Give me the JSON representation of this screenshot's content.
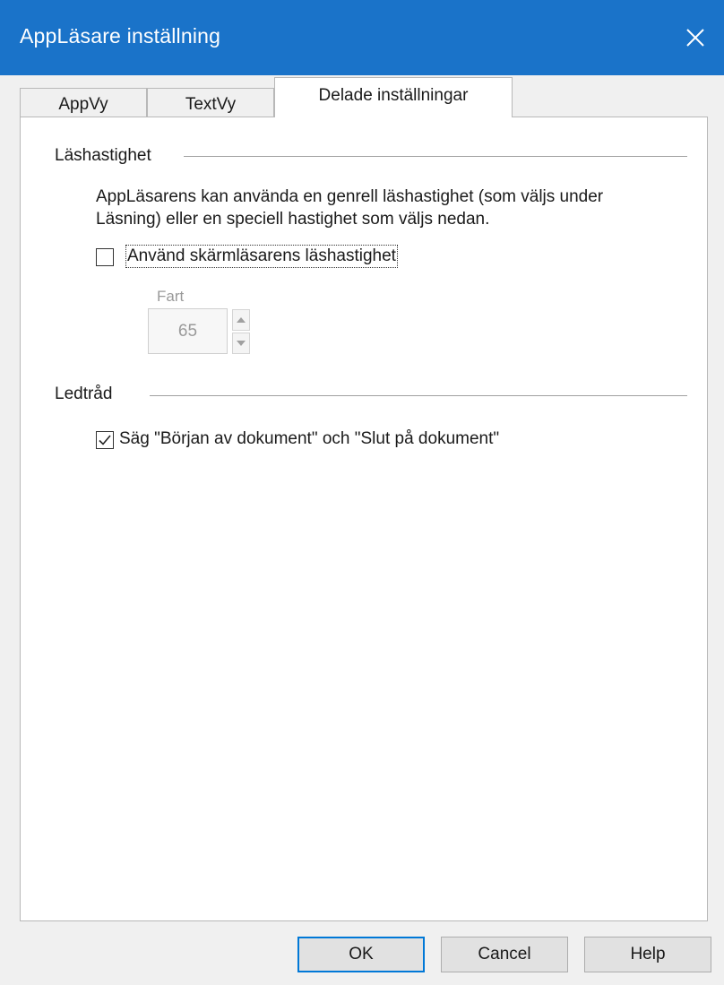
{
  "window": {
    "title": "AppLäsare inställning"
  },
  "tabs": [
    {
      "label": "AppVy",
      "active": false
    },
    {
      "label": "TextVy",
      "active": false
    },
    {
      "label": "Delade inställningar",
      "active": true
    }
  ],
  "reading_speed": {
    "group_label": "Läshastighet",
    "description": "AppLäsarens kan använda en genrell läshastighet (som väljs under Läsning) eller en speciell hastighet som väljs nedan.",
    "use_screenreader_speed_label": "Använd skärmläsarens läshastighet",
    "use_screenreader_speed_checked": false,
    "speed_label": "Fart",
    "speed_value": "65"
  },
  "hint": {
    "group_label": "Ledtråd",
    "say_document_label": "Säg \"Början av dokument\" och \"Slut på dokument\"",
    "say_document_checked": true
  },
  "buttons": {
    "ok": "OK",
    "cancel": "Cancel",
    "help": "Help"
  },
  "colors": {
    "titlebar": "#1a73c9",
    "focus_border": "#0078d7"
  }
}
